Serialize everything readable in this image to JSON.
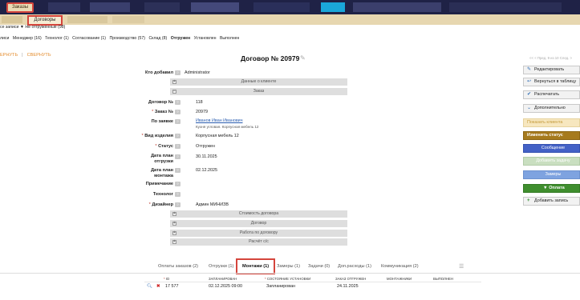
{
  "topnav": {
    "tab_orders": "Заказы"
  },
  "subnav": {
    "tab_contracts": "Договоры"
  },
  "filter": {
    "text": "се записи ▼  Не отгруженные (98)"
  },
  "status_filter": {
    "items": [
      "лиси",
      "Менеджер (16)",
      "Технолог (1)",
      "Согласование (1)",
      "Производство (57)",
      "Склад (8)",
      "Отгружен",
      "Установлен",
      "Выполнен"
    ]
  },
  "expand": {
    "expand_label": "ЕРНУТЬ",
    "separator": "|",
    "collapse_label": "СВЕРНУТЬ"
  },
  "document": {
    "title": "Договор № 20979",
    "pager": "<< < Пред.   9 из 10   След. >"
  },
  "form": {
    "added_by_label": "Кто добавил",
    "added_by_value": "Administrator",
    "sections": {
      "client": "Данные о клиенте",
      "order": "Заказ",
      "cost": "Стоимость договора",
      "contract": "Договор",
      "work": "Работа по договору",
      "calc": "Расчёт с/с"
    },
    "contract_no_label": "Договор №",
    "contract_no_value": "118",
    "order_no_label": "Заказ №",
    "order_no_value": "20979",
    "by_order_label": "По заявке",
    "by_order_value": "Иванов Иван Иванович",
    "by_order_sub": "Кухня угловая. Корпусная мебель 12",
    "product_label": "Вид изделия",
    "product_value": "Корпусная мебель 12",
    "status_label": "Статус",
    "status_value": "Отгружен",
    "ship_date_label_1": "Дата план",
    "ship_date_label_2": "отгрузки",
    "ship_date_value": "30.11.2025",
    "install_date_label_1": "Дата план",
    "install_date_label_2": "монтажа",
    "install_date_value": "02.12.2025",
    "note_label": "Примечание",
    "technologist_label": "Технолог",
    "designer_label": "Дизайнер",
    "designer_value": "Админ МИНИЗВ",
    "hint_mark": "?"
  },
  "actions": {
    "edit": "Редактировать",
    "back": "Вернуться в таблицу",
    "print": "Распечатать",
    "more": "Дополнительно",
    "show_client": "Показать клиента",
    "change_status": "Изменить статус",
    "message": "Сообщение",
    "add_task": "Добавить задачу",
    "measurements": "Замеры",
    "payment": "Оплата",
    "add_record": "Добавить запись"
  },
  "colors": {
    "topbar": "#1f2246",
    "subbar": "#e7d7b0",
    "highlight_border": "#d5453c",
    "show_client_bg": "#f7e7bf",
    "change_status_bg": "#a67a1d",
    "message_bg": "#4361c6",
    "add_task_bg": "#c9dfc0",
    "measurements_bg": "#7ea3e0",
    "payment_bg": "#3f8e2e"
  },
  "bottom_tabs": [
    "Оплаты заказов (2)",
    "Отгрузки (1)",
    "Монтажи (1)",
    "Замеры (1)",
    "Задачи (0)",
    "Доп.расходы (1)",
    "Коммуникация (2)"
  ],
  "table": {
    "headers": {
      "id": "ID",
      "planned": "ЗАПЛАНИРОВАН",
      "state": "СОСТОЯНИЕ УСТАНОВКИ",
      "shipped": "ЗАКАЗ ОТГРУЖЕН",
      "installers": "МОНТАЖНИКИ",
      "done": "ВЫПОЛНЕН"
    },
    "rows": [
      {
        "id": "17 577",
        "planned": "02.12.2025 09:00",
        "state": "Запланирован",
        "shipped": "24.11.2025",
        "installers": "",
        "done": ""
      }
    ]
  }
}
